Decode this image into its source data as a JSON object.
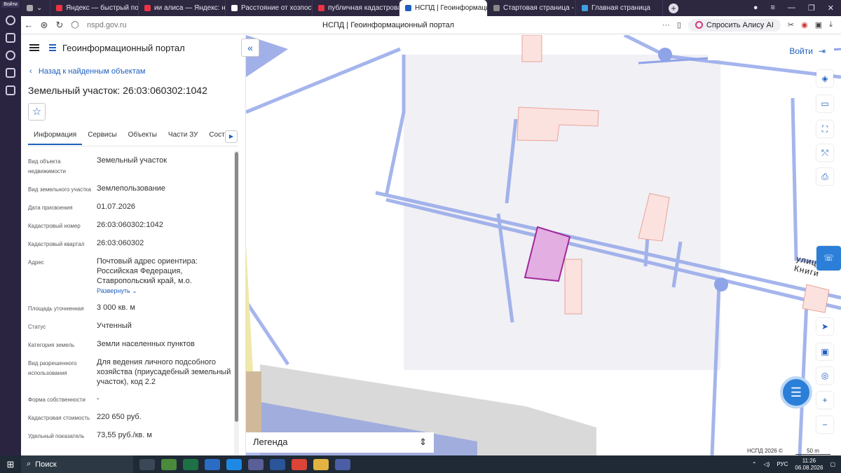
{
  "browser": {
    "login_label": "Войти",
    "tabs": [
      {
        "label": "Яндекс — быстрый поиск",
        "color": "#e34"
      },
      {
        "label": "ии алиса — Яндекс: нашл",
        "color": "#e34"
      },
      {
        "label": "Расстояние от хозпостро",
        "color": "#fff"
      },
      {
        "label": "публичная кадастровая к",
        "color": "#e34"
      },
      {
        "label": "НСПД | Геоинформаци",
        "color": "#1f5fbf"
      },
      {
        "label": "Стартовая страница - Ко",
        "color": "#888"
      },
      {
        "label": "Главная страница",
        "color": "#3aa0e0"
      }
    ],
    "url": "nspd.gov.ru",
    "page_title": "НСПД | Геоинформационный портал",
    "alisa_label": "Спросить Алису AI"
  },
  "panel": {
    "app_title": "Геоинформационный портал",
    "back_label": "Назад к найденным объектам",
    "object_title": "Земельный участок: 26:03:060302:1042",
    "tabs": [
      "Информация",
      "Сервисы",
      "Объекты",
      "Части ЗУ",
      "Состав"
    ],
    "props": [
      {
        "k": "Вид объекта недвижимости",
        "v": "Земельный участок"
      },
      {
        "k": "Вид земельного участка",
        "v": "Землепользование"
      },
      {
        "k": "Дата присвоения",
        "v": "01.07.2026"
      },
      {
        "k": "Кадастровый номер",
        "v": "26:03:060302:1042"
      },
      {
        "k": "Кадастровый квартал",
        "v": "26:03:060302"
      },
      {
        "k": "Адрес",
        "v": "Почтовый адрес ориентира: Российская Федерация, Ставропольский край, м.о.",
        "expand": "Развернуть"
      },
      {
        "k": "Площадь уточненная",
        "v": "3 000 кв. м"
      },
      {
        "k": "Статус",
        "v": "Учтенный"
      },
      {
        "k": "Категория земель",
        "v": "Земли населенных пунктов"
      },
      {
        "k": "Вид разрешенного использования",
        "v": "Для ведения личного подсобного хозяйства (приусадебный земельный участок), код 2.2"
      },
      {
        "k": "Форма собственности",
        "v": "-"
      },
      {
        "k": "Кадастровая стоимость",
        "v": "220 650 руб."
      },
      {
        "k": "Удельный показатель",
        "v": "73,55 руб./кв. м"
      }
    ]
  },
  "map": {
    "login_label": "Войти",
    "street_label": "улица Книги",
    "legend_label": "Легенда",
    "copyright": "НСПД 2026 ©",
    "scale": "50 m"
  },
  "taskbar": {
    "search_label": "Поиск",
    "lang": "РУС",
    "time": "11:26",
    "date": "06.08.2026"
  }
}
